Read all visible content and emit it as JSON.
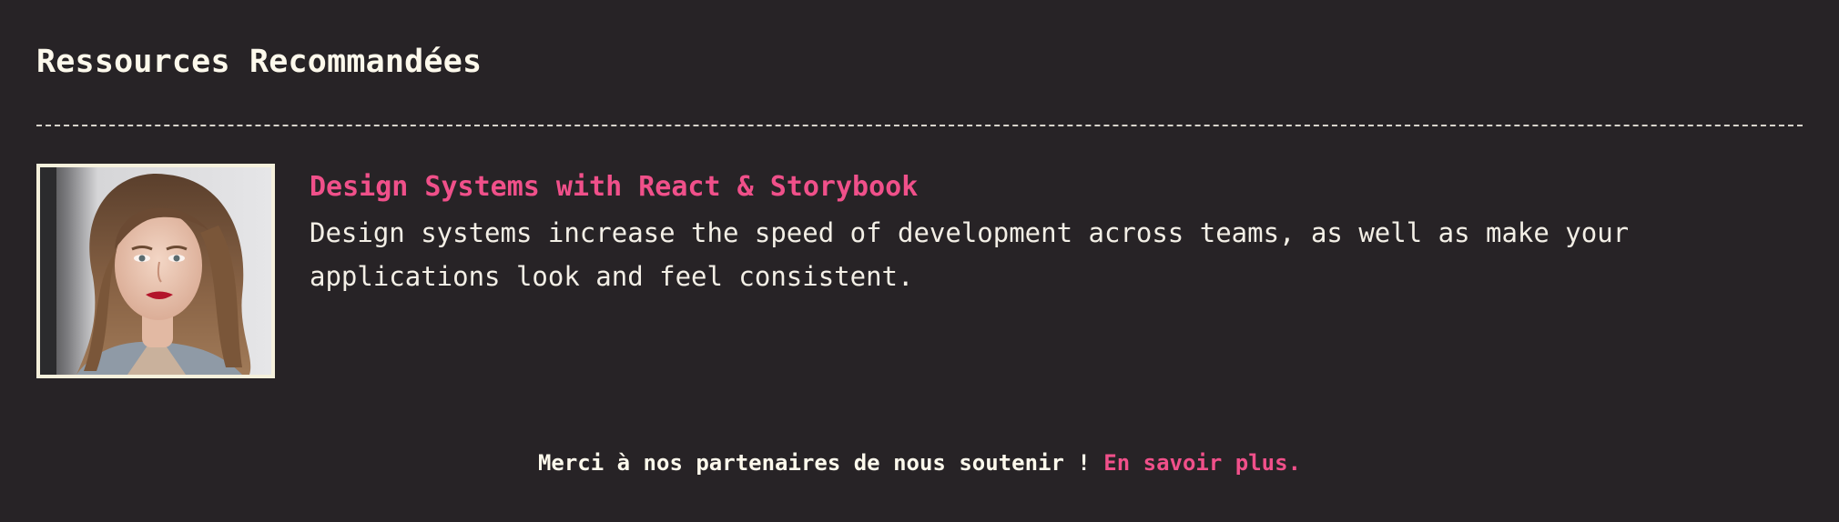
{
  "section": {
    "title": "Ressources Recommandées"
  },
  "resource": {
    "title": "Design Systems with React & Storybook",
    "description": "Design systems increase the speed of development across teams, as well as make your applications look and feel consistent."
  },
  "footer": {
    "text": "Merci à nos partenaires de nous soutenir ! ",
    "link_label": "En savoir plus."
  },
  "colors": {
    "background": "#272326",
    "accent": "#f0508a",
    "text": "#fdf9ec"
  }
}
